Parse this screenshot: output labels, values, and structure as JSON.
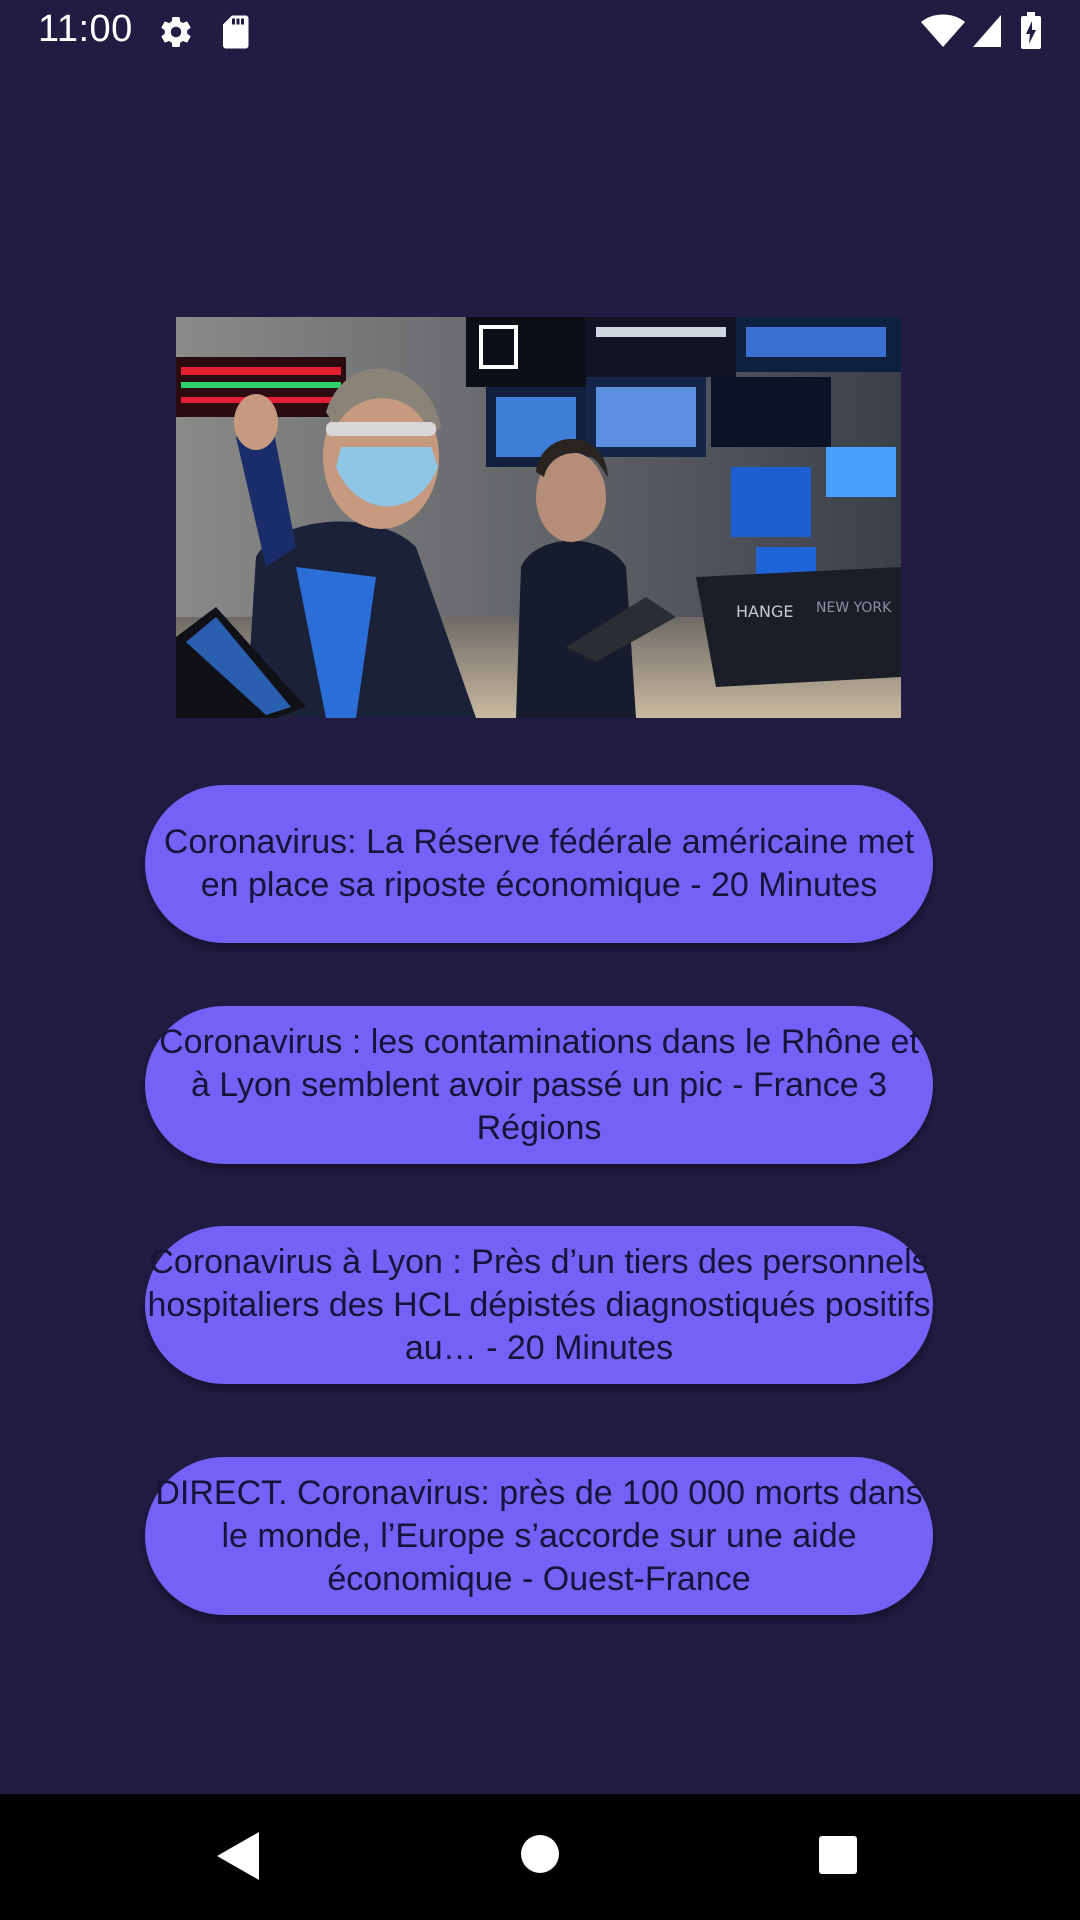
{
  "status_bar": {
    "time": "11:00",
    "icons": [
      "gear-icon",
      "sd-card-icon",
      "wifi-icon",
      "signal-icon",
      "battery-icon"
    ]
  },
  "hero_image": {
    "description_icon": "stock-exchange-photo"
  },
  "news": [
    {
      "label": "Coronavirus: La Réserve fédérale américaine met en place sa riposte économique - 20 Minutes"
    },
    {
      "label": "Coronavirus : les contaminations dans le Rhône et à Lyon semblent avoir passé un pic - France 3 Régions"
    },
    {
      "label": "Coronavirus à Lyon : Près d’un tiers des personnels hospitaliers des HCL dépistés diagnostiqués positifs au… - 20 Minutes"
    },
    {
      "label": "DIRECT. Coronavirus: près de 100 000 morts dans le monde, l’Europe s’accorde sur une aide économique - Ouest-France"
    }
  ],
  "nav_bar": {
    "icons": [
      "back-icon",
      "home-icon",
      "recents-icon"
    ]
  },
  "colors": {
    "background": "#221c43",
    "button": "#7462f7",
    "button_text": "#17143a",
    "nav_bar": "#000000"
  }
}
